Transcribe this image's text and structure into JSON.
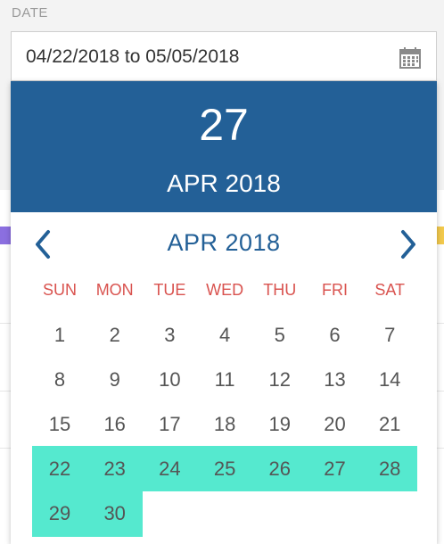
{
  "field": {
    "label": "DATE",
    "value": "04/22/2018 to 05/05/2018"
  },
  "icons": {
    "calendar": "calendar-icon",
    "prev": "chevron-left-icon",
    "next": "chevron-right-icon"
  },
  "colors": {
    "header": "#236097",
    "weekday": "#d9534f",
    "range": "#55e9cf"
  },
  "picker": {
    "selected_day": "27",
    "selected_month": "APR 2018",
    "month_title": "APR 2018",
    "weekdays": [
      "SUN",
      "MON",
      "TUE",
      "WED",
      "THU",
      "FRI",
      "SAT"
    ],
    "weeks": [
      [
        "1",
        "2",
        "3",
        "4",
        "5",
        "6",
        "7"
      ],
      [
        "8",
        "9",
        "10",
        "11",
        "12",
        "13",
        "14"
      ],
      [
        "15",
        "16",
        "17",
        "18",
        "19",
        "20",
        "21"
      ],
      [
        "22",
        "23",
        "24",
        "25",
        "26",
        "27",
        "28"
      ],
      [
        "29",
        "30"
      ]
    ],
    "range_start": "22",
    "range_end": "30"
  }
}
